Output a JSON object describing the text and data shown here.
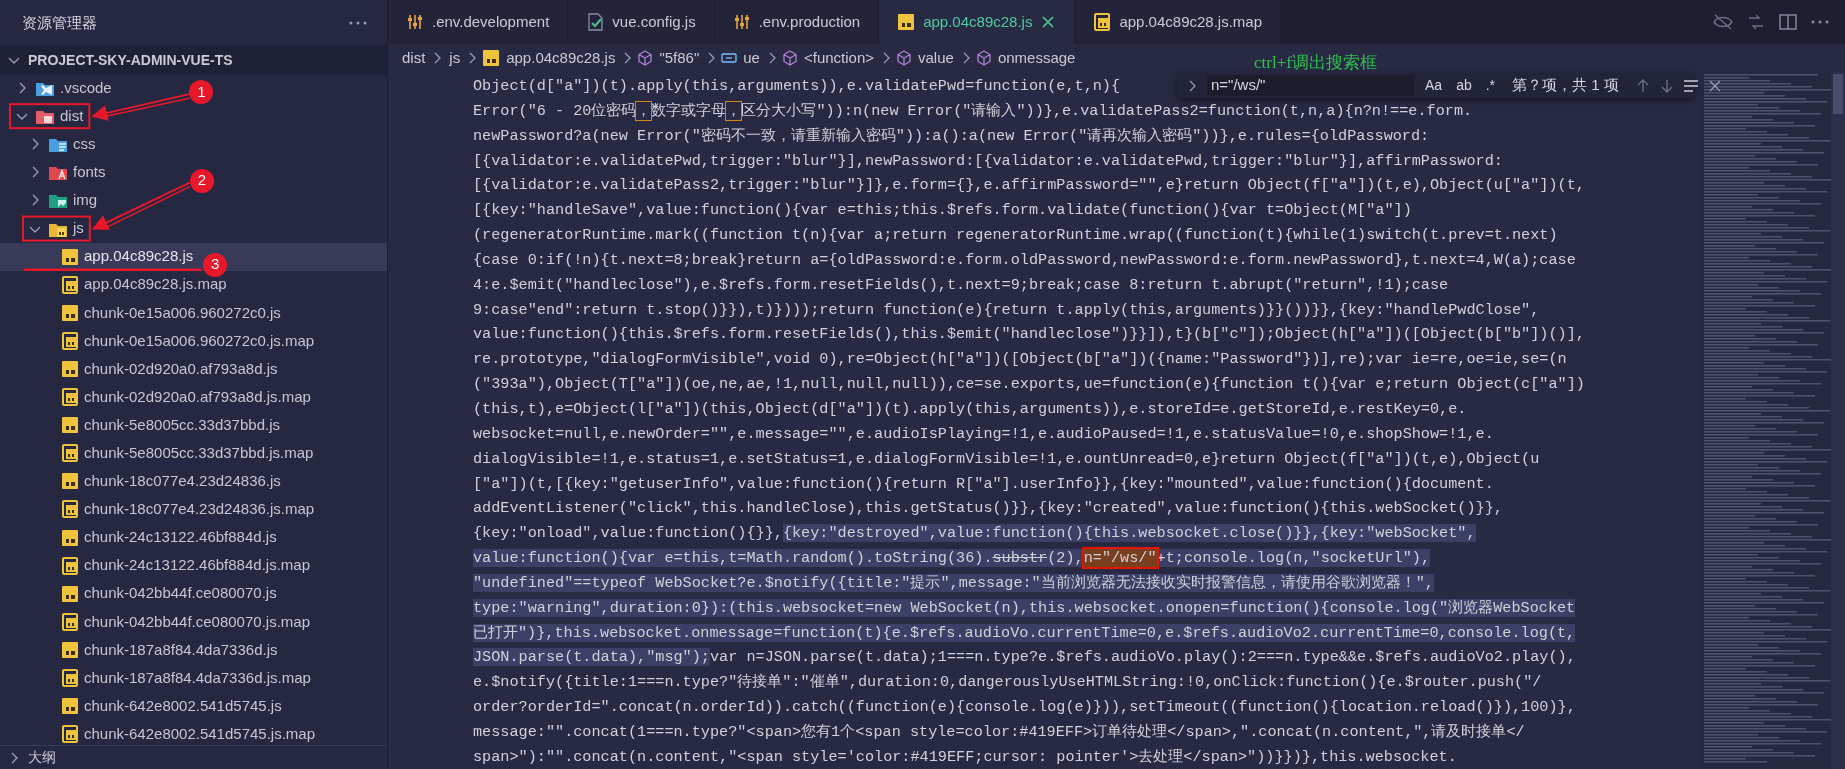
{
  "sidebar": {
    "title": "资源管理器",
    "section": {
      "label": "PROJECT-SKY-ADMIN-VUE-TS",
      "expanded": true
    },
    "tree": [
      {
        "label": ".vscode",
        "kind": "vscode",
        "expanded": false,
        "selected": false
      },
      {
        "label": "dist",
        "kind": "dist",
        "expanded": true,
        "selected": false,
        "marker": "1",
        "children": [
          {
            "label": "css",
            "kind": "css",
            "expanded": false,
            "selected": false
          },
          {
            "label": "fonts",
            "kind": "fonts",
            "expanded": false,
            "selected": false
          },
          {
            "label": "img",
            "kind": "img",
            "expanded": false,
            "selected": false
          },
          {
            "label": "js",
            "kind": "js-folder",
            "expanded": true,
            "selected": false,
            "marker": "2",
            "children": [
              {
                "label": "app.04c89c28.js",
                "kind": "js",
                "selected": true,
                "marker": "3"
              },
              {
                "label": "app.04c89c28.js.map",
                "kind": "map",
                "selected": false
              },
              {
                "label": "chunk-0e15a006.960272c0.js",
                "kind": "js",
                "selected": false
              },
              {
                "label": "chunk-0e15a006.960272c0.js.map",
                "kind": "map",
                "selected": false
              },
              {
                "label": "chunk-02d920a0.af793a8d.js",
                "kind": "js",
                "selected": false
              },
              {
                "label": "chunk-02d920a0.af793a8d.js.map",
                "kind": "map",
                "selected": false
              },
              {
                "label": "chunk-5e8005cc.33d37bbd.js",
                "kind": "js",
                "selected": false
              },
              {
                "label": "chunk-5e8005cc.33d37bbd.js.map",
                "kind": "map",
                "selected": false
              },
              {
                "label": "chunk-18c077e4.23d24836.js",
                "kind": "js",
                "selected": false
              },
              {
                "label": "chunk-18c077e4.23d24836.js.map",
                "kind": "map",
                "selected": false
              },
              {
                "label": "chunk-24c13122.46bf884d.js",
                "kind": "js",
                "selected": false
              },
              {
                "label": "chunk-24c13122.46bf884d.js.map",
                "kind": "map",
                "selected": false
              },
              {
                "label": "chunk-042bb44f.ce080070.js",
                "kind": "js",
                "selected": false
              },
              {
                "label": "chunk-042bb44f.ce080070.js.map",
                "kind": "map",
                "selected": false
              },
              {
                "label": "chunk-187a8f84.4da7336d.js",
                "kind": "js",
                "selected": false
              },
              {
                "label": "chunk-187a8f84.4da7336d.js.map",
                "kind": "map",
                "selected": false
              },
              {
                "label": "chunk-642e8002.541d5745.js",
                "kind": "js",
                "selected": false
              },
              {
                "label": "chunk-642e8002.541d5745.js.map",
                "kind": "map",
                "selected": false
              }
            ]
          }
        ]
      }
    ],
    "outline": {
      "label": "大纲",
      "expanded": false
    }
  },
  "tabs": [
    {
      "label": ".env.development",
      "kind": "env",
      "selected": false
    },
    {
      "label": "vue.config.js",
      "kind": "vue",
      "selected": false
    },
    {
      "label": ".env.production",
      "kind": "env",
      "selected": false
    },
    {
      "label": "app.04c89c28.js",
      "kind": "js",
      "selected": true
    },
    {
      "label": "app.04c89c28.js.map",
      "kind": "map",
      "selected": false
    }
  ],
  "breadcrumbs": [
    {
      "label": "dist",
      "kind": "folder"
    },
    {
      "label": "js",
      "kind": "folder"
    },
    {
      "label": "app.04c89c28.js",
      "kind": "js"
    },
    {
      "label": "\"5f86\"",
      "kind": "module"
    },
    {
      "label": "ue",
      "kind": "variable"
    },
    {
      "label": "<function>",
      "kind": "module"
    },
    {
      "label": "value",
      "kind": "module"
    },
    {
      "label": "onmessage",
      "kind": "module"
    }
  ],
  "find": {
    "query": "n=\"/ws/\"",
    "options": [
      {
        "label": "Aa",
        "on": false
      },
      {
        "label": "ab",
        "on": false
      },
      {
        "label": ".*",
        "on": false
      }
    ],
    "status": "第？项，共 1 项",
    "hint": "ctrl+f调出搜索框"
  },
  "code": [
    {
      "text": "Object(d[\"a\"])(t).apply(this,arguments)),e.validatePwd=function(e,t,n){"
    },
    {
      "segments": [
        {
          "kind": "plain",
          "text": "Error(\"6 - 20位密码"
        },
        {
          "kind": "outlined",
          "text": "，"
        },
        {
          "kind": "plain",
          "text": "数字或字母"
        },
        {
          "kind": "outlined",
          "text": "，"
        },
        {
          "kind": "plain",
          "text": "区分大小写\")):n(new Error(\"请输入\"))},e.validatePass2=function(t,n,a){n?n!==e.form."
        }
      ]
    },
    {
      "text": "newPassword?a(new Error(\"密码不一致，请重新输入密码\")):a():a(new Error(\"请再次输入密码\"))},e.rules={oldPassword:"
    },
    {
      "text": "[{validator:e.validatePwd,trigger:\"blur\"}],newPassword:[{validator:e.validatePwd,trigger:\"blur\"}],affirmPassword:"
    },
    {
      "text": "[{validator:e.validatePass2,trigger:\"blur\"}]},e.form={},e.affirmPassword=\"\",e}return Object(f[\"a\"])(t,e),Object(u[\"a\"])(t,"
    },
    {
      "text": "[{key:\"handleSave\",value:function(){var e=this;this.$refs.form.validate(function(){var t=Object(M[\"a\"])"
    },
    {
      "text": "(regeneratorRuntime.mark((function t(n){var a;return regeneratorRuntime.wrap((function(t){while(1)switch(t.prev=t.next)"
    },
    {
      "text": "{case 0:if(!n){t.next=8;break}return a={oldPassword:e.form.oldPassword,newPassword:e.form.newPassword},t.next=4,W(a);case"
    },
    {
      "text": "4:e.$emit(\"handleclose\"),e.$refs.form.resetFields(),t.next=9;break;case 8:return t.abrupt(\"return\",!1);case"
    },
    {
      "text": "9:case\"end\":return t.stop()}}),t)})));return function(e){return t.apply(this,arguments)}}())}},{key:\"handlePwdClose\","
    },
    {
      "text": "value:function(){this.$refs.form.resetFields(),this.$emit(\"handleclose\")}}]),t}(b[\"c\"]);Object(h[\"a\"])([Object(b[\"b\"])()],"
    },
    {
      "text": "re.prototype,\"dialogFormVisible\",void 0),re=Object(h[\"a\"])([Object(b[\"a\"])({name:\"Password\"})],re);var ie=re,oe=ie,se=(n"
    },
    {
      "text": "(\"393a\"),Object(T[\"a\"])(oe,ne,ae,!1,null,null,null)),ce=se.exports,ue=function(e){function t(){var e;return Object(c[\"a\"])"
    },
    {
      "text": "(this,t),e=Object(l[\"a\"])(this,Object(d[\"a\"])(t).apply(this,arguments)),e.storeId=e.getStoreId,e.restKey=0,e."
    },
    {
      "text": "websocket=null,e.newOrder=\"\",e.message=\"\",e.audioIsPlaying=!1,e.audioPaused=!1,e.statusValue=!0,e.shopShow=!1,e."
    },
    {
      "text": "dialogVisible=!1,e.status=1,e.setStatus=1,e.dialogFormVisible=!1,e.ountUnread=0,e}return Object(f[\"a\"])(t,e),Object(u"
    },
    {
      "text": "[\"a\"])(t,[{key:\"getuserInfo\",value:function(){return R[\"a\"].userInfo}},{key:\"mounted\",value:function(){document."
    },
    {
      "text": "addEventListener(\"click\",this.handleClose),this.getStatus()}},{key:\"created\",value:function(){this.webSocket()}},"
    },
    {
      "segments": [
        {
          "kind": "plain",
          "text": "{key:\"onload\",value:function(){}},"
        },
        {
          "kind": "selected",
          "text": "{key:\"destroyed\",value:function(){this.websocket.close()}},{key:\"webSocket\","
        }
      ]
    },
    {
      "segments": [
        {
          "kind": "selected",
          "text": "value:function(){var e=this,t=Math.random().toString(36)."
        },
        {
          "kind": "selected-strike",
          "text": "substr"
        },
        {
          "kind": "selected",
          "text": "(2),"
        },
        {
          "kind": "match",
          "text": "n=\"/ws/\""
        },
        {
          "kind": "selected",
          "text": "+t;console.log(n,\"socketUrl\"),"
        }
      ]
    },
    {
      "segments": [
        {
          "kind": "selected",
          "text": "\"undefined\"==typeof WebSocket?e.$notify({title:\"提示\",message:\"当前浏览器无法接收实时报警信息，请使用谷歌浏览器！\","
        }
      ]
    },
    {
      "segments": [
        {
          "kind": "selected",
          "text": "type:\"warning\",duration:0}):(this.websocket=new WebSocket(n),this.websocket.onopen=function(){console.log(\"浏览器WebSocket"
        }
      ]
    },
    {
      "segments": [
        {
          "kind": "selected",
          "text": "已打开\")},this.websocket.onmessage=function(t){e.$refs.audioVo.currentTime=0,e.$refs.audioVo2.currentTime=0,console.log(t,"
        }
      ]
    },
    {
      "segments": [
        {
          "kind": "selected",
          "text": "JSON.parse(t.data),\"msg\");"
        },
        {
          "kind": "plain",
          "text": "var n=JSON.parse(t.data);1===n.type?e.$refs.audioVo.play():2===n.type&&e.$refs.audioVo2.play(),"
        }
      ]
    },
    {
      "text": "e.$notify({title:1===n.type?\"待接单\":\"催单\",duration:0,dangerouslyUseHTMLString:!0,onClick:function(){e.$router.push(\"/"
    },
    {
      "text": "order?orderId=\".concat(n.orderId)).catch((function(e){console.log(e)})),setTimeout((function(){location.reload()}),100)},"
    },
    {
      "text": "message:\"\".concat(1===n.type?\"<span>您有1个<span style=color:#419EFF>订单待处理</span>,\".concat(n.content,\",请及时接单</"
    },
    {
      "text": "span>\"):\"\".concat(n.content,\"<span style='color:#419EFF;cursor: pointer'>去处理</span>\"))}})},this.websocket."
    }
  ]
}
